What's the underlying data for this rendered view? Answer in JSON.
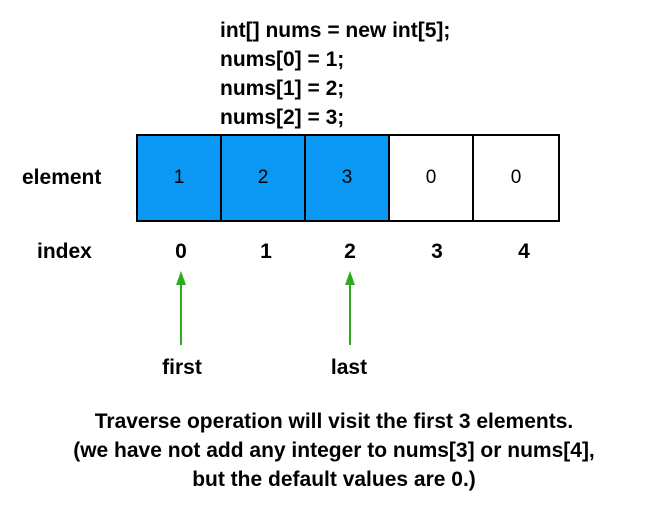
{
  "code": {
    "lines": [
      "int[] nums = new int[5];",
      "nums[0] = 1;",
      "nums[1] = 2;",
      "nums[2] = 3;"
    ]
  },
  "labels": {
    "element": "element",
    "index": "index"
  },
  "array": {
    "elements": [
      "1",
      "2",
      "3",
      "0",
      "0"
    ],
    "indices": [
      "0",
      "1",
      "2",
      "3",
      "4"
    ],
    "filled_count": 3,
    "filled_color": "#0b97f4",
    "empty_color": "#ffffff"
  },
  "pointers": {
    "first": {
      "label": "first",
      "index": 0
    },
    "last": {
      "label": "last",
      "index": 2
    },
    "arrow_color": "#2dab1e"
  },
  "caption": {
    "lines": [
      "Traverse operation will visit the first 3 elements.",
      "(we have not add any integer to nums[3] or nums[4],",
      "but the default values are 0.)"
    ]
  }
}
